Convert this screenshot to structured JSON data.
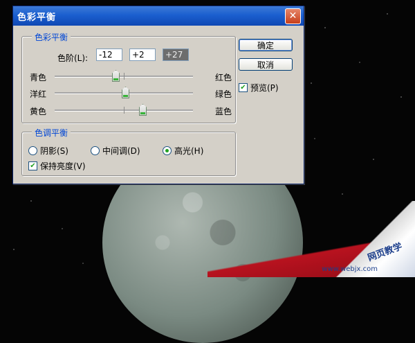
{
  "dialog": {
    "title": "色彩平衡",
    "close_glyph": "✕"
  },
  "color_balance": {
    "legend": "色彩平衡",
    "levels_label": "色阶(L):",
    "levels": [
      "-12",
      "+2",
      "+27"
    ],
    "sliders": [
      {
        "left": "青色",
        "right": "红色",
        "value": -12
      },
      {
        "left": "洋红",
        "right": "绿色",
        "value": 2
      },
      {
        "left": "黄色",
        "right": "蓝色",
        "value": 27
      }
    ],
    "slider_range": [
      -100,
      100
    ]
  },
  "tone_balance": {
    "legend": "色调平衡",
    "options": [
      {
        "label": "阴影(S)",
        "selected": false
      },
      {
        "label": "中间调(D)",
        "selected": false
      },
      {
        "label": "高光(H)",
        "selected": true
      }
    ],
    "preserve_luminosity_label": "保持亮度(V)",
    "preserve_luminosity": true
  },
  "buttons": {
    "ok": "确定",
    "cancel": "取消"
  },
  "preview": {
    "label": "预览(P)",
    "checked": true
  },
  "background": {
    "watermark": "网页教学",
    "watermark_url": "www.webjx.com"
  },
  "colors": {
    "title_bar": "#1b5fcf",
    "legend_text": "#0046d5",
    "check_green": "#21a121",
    "dialog_face": "#d4d0c8"
  },
  "icons": {
    "close": "close-icon",
    "check": "check-icon",
    "radio": "radio-dot-icon"
  }
}
